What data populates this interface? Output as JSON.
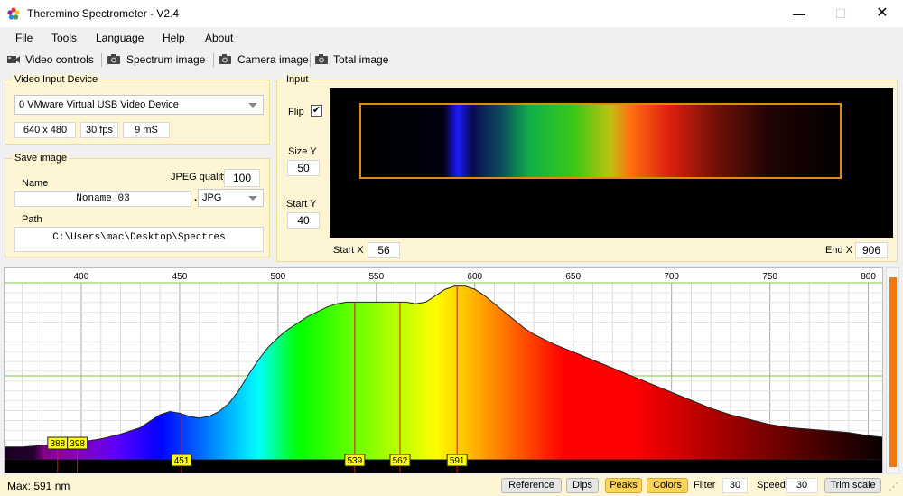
{
  "window": {
    "title": "Theremino Spectrometer - V2.4",
    "minimize": "—",
    "maximize": "☐",
    "close": "✕"
  },
  "menu": [
    "File",
    "Tools",
    "Language",
    "Help",
    "About"
  ],
  "toolbar": {
    "video_controls": "Video controls",
    "spectrum_image": "Spectrum image",
    "camera_image": "Camera image",
    "total_image": "Total image"
  },
  "video_input": {
    "title": "Video Input Device",
    "device": "0 VMware Virtual USB Video Device",
    "resolution": "640 x 480",
    "fps": "30 fps",
    "exposure": "9 mS"
  },
  "save_image": {
    "title": "Save image",
    "name_label": "Name",
    "name_value": "Noname_03",
    "jpeg_quality_label": "JPEG quality",
    "jpeg_quality": "100",
    "format_sep": ".",
    "format": "JPG",
    "path_label": "Path",
    "path_value": "C:\\Users\\mac\\Desktop\\Spectres"
  },
  "input": {
    "title": "Input",
    "flip_label": "Flip",
    "flip_checked": true,
    "size_y_label": "Size Y",
    "size_y": "50",
    "start_y_label": "Start Y",
    "start_y": "40",
    "start_x_label": "Start X",
    "start_x": "56",
    "end_x_label": "End X",
    "end_x": "906"
  },
  "chart_data": {
    "type": "area",
    "title": "",
    "xlabel": "",
    "ylabel": "",
    "x_unit": "nm",
    "xlim": [
      361,
      808
    ],
    "ylim": [
      0,
      1
    ],
    "x_ticks": [
      400,
      450,
      500,
      550,
      600,
      650,
      700,
      750,
      800
    ],
    "grid": true,
    "x": [
      361,
      370,
      380,
      390,
      400,
      410,
      420,
      430,
      435,
      440,
      445,
      450,
      455,
      460,
      465,
      470,
      475,
      480,
      485,
      490,
      495,
      500,
      505,
      510,
      515,
      520,
      525,
      530,
      535,
      540,
      545,
      550,
      555,
      560,
      565,
      570,
      575,
      580,
      585,
      590,
      595,
      600,
      605,
      610,
      615,
      620,
      625,
      630,
      640,
      650,
      660,
      670,
      680,
      690,
      700,
      710,
      720,
      730,
      740,
      750,
      760,
      770,
      780,
      790,
      800,
      808
    ],
    "values": [
      0.08,
      0.08,
      0.09,
      0.1,
      0.11,
      0.13,
      0.16,
      0.2,
      0.24,
      0.28,
      0.3,
      0.29,
      0.27,
      0.26,
      0.27,
      0.3,
      0.35,
      0.43,
      0.53,
      0.62,
      0.7,
      0.76,
      0.81,
      0.85,
      0.89,
      0.92,
      0.95,
      0.97,
      0.98,
      0.98,
      0.98,
      0.98,
      0.98,
      0.98,
      0.98,
      0.97,
      0.98,
      1.02,
      1.06,
      1.08,
      1.08,
      1.06,
      1.02,
      0.97,
      0.92,
      0.87,
      0.82,
      0.78,
      0.72,
      0.67,
      0.62,
      0.57,
      0.52,
      0.47,
      0.42,
      0.37,
      0.32,
      0.28,
      0.25,
      0.22,
      0.2,
      0.19,
      0.18,
      0.17,
      0.15,
      0.14
    ],
    "peaks": [
      388,
      398,
      451,
      539,
      562,
      591
    ]
  },
  "status": {
    "max_text": "Max: 591 nm",
    "reference": "Reference",
    "dips": "Dips",
    "peaks": "Peaks",
    "colors": "Colors",
    "filter_label": "Filter",
    "filter": "30",
    "speed_label": "Speed",
    "speed": "30",
    "trim_scale": "Trim scale"
  },
  "colors": {
    "panel_bg": "#fdf5d4",
    "accent_orange": "#f07a10",
    "peak_label_bg": "#ffff00",
    "button_on": "#ffd35a"
  }
}
